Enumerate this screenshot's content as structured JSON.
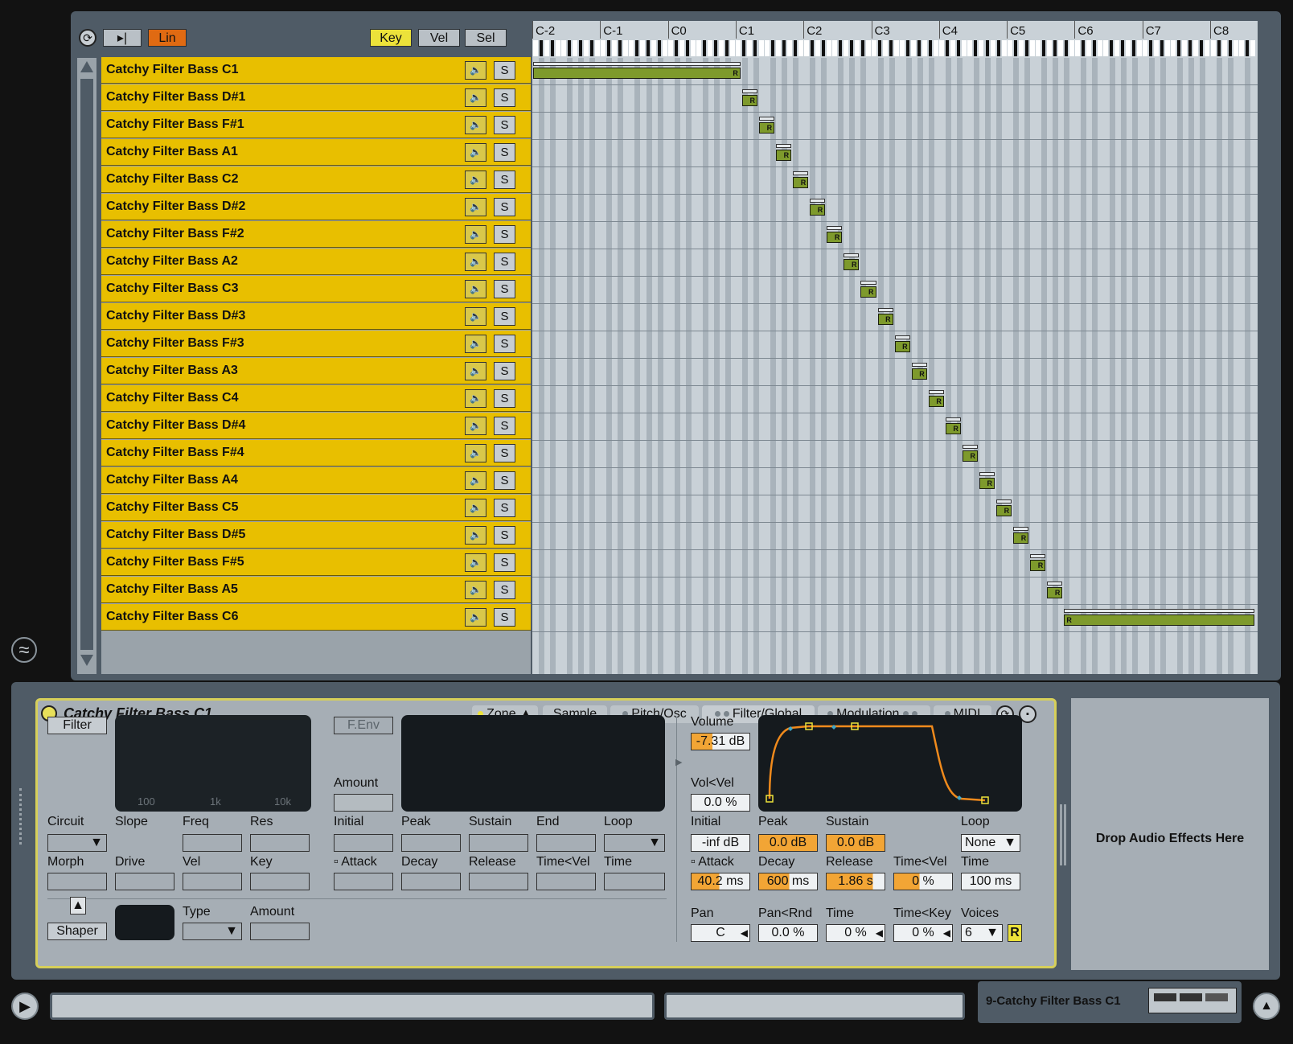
{
  "toolbar": {
    "lin_label": "Lin",
    "key_label": "Key",
    "vel_label": "Vel",
    "sel_label": "Sel"
  },
  "ruler_labels": [
    "C-2",
    "C-1",
    "C0",
    "C1",
    "C2",
    "C3",
    "C4",
    "C5",
    "C6",
    "C7",
    "C8"
  ],
  "zones": [
    {
      "name": "Catchy Filter Bass C1"
    },
    {
      "name": "Catchy Filter Bass D#1"
    },
    {
      "name": "Catchy Filter Bass F#1"
    },
    {
      "name": "Catchy Filter Bass A1"
    },
    {
      "name": "Catchy Filter Bass C2"
    },
    {
      "name": "Catchy Filter Bass D#2"
    },
    {
      "name": "Catchy Filter Bass F#2"
    },
    {
      "name": "Catchy Filter Bass A2"
    },
    {
      "name": "Catchy Filter Bass C3"
    },
    {
      "name": "Catchy Filter Bass D#3"
    },
    {
      "name": "Catchy Filter Bass F#3"
    },
    {
      "name": "Catchy Filter Bass A3"
    },
    {
      "name": "Catchy Filter Bass C4"
    },
    {
      "name": "Catchy Filter Bass D#4"
    },
    {
      "name": "Catchy Filter Bass F#4"
    },
    {
      "name": "Catchy Filter Bass A4"
    },
    {
      "name": "Catchy Filter Bass C5"
    },
    {
      "name": "Catchy Filter Bass D#5"
    },
    {
      "name": "Catchy Filter Bass F#5"
    },
    {
      "name": "Catchy Filter Bass A5"
    },
    {
      "name": "Catchy Filter Bass C6"
    }
  ],
  "zone_row_labels": {
    "solo": "S",
    "range_marker": "R"
  },
  "device": {
    "title": "Catchy Filter Bass C1",
    "tabs": {
      "zone": "Zone",
      "sample": "Sample",
      "pitch": "Pitch/Osc",
      "filter": "Filter/Global",
      "modulation": "Modulation",
      "midi": "MIDI"
    },
    "filter": {
      "filter_button": "Filter",
      "fenv_button": "F.Env",
      "amount_label": "Amount",
      "freq_ticks": [
        "100",
        "1k",
        "10k"
      ],
      "circuit": "Circuit",
      "slope": "Slope",
      "freq": "Freq",
      "res": "Res",
      "morph": "Morph",
      "drive": "Drive",
      "vel": "Vel",
      "key": "Key",
      "shaper": "Shaper",
      "type": "Type",
      "shaper_amount": "Amount"
    },
    "fenv": {
      "initial": "Initial",
      "peak": "Peak",
      "sustain": "Sustain",
      "end": "End",
      "loop": "Loop",
      "attack": "Attack",
      "decay": "Decay",
      "release": "Release",
      "time_vel": "Time<Vel",
      "time": "Time"
    },
    "amp": {
      "volume_label": "Volume",
      "volume_value": "-7.31 dB",
      "volvel_label": "Vol<Vel",
      "volvel_value": "0.0 %",
      "initial_label": "Initial",
      "initial_value": "-inf dB",
      "peak_label": "Peak",
      "peak_value": "0.0 dB",
      "sustain_label": "Sustain",
      "sustain_value": "0.0 dB",
      "loop_label": "Loop",
      "loop_value": "None",
      "attack_label": "Attack",
      "attack_value": "40.2 ms",
      "decay_label": "Decay",
      "decay_value": "600 ms",
      "release_label": "Release",
      "release_value": "1.86 s",
      "timevel_label": "Time<Vel",
      "timevel_value": "0 %",
      "time_label": "Time",
      "time_value": "100 ms",
      "pan_label": "Pan",
      "pan_value": "C",
      "panrnd_label": "Pan<Rnd",
      "panrnd_value": "0.0 %",
      "ptime_label": "Time",
      "ptime_value": "0 %",
      "timekey_label": "Time<Key",
      "timekey_value": "0 %",
      "voices_label": "Voices",
      "voices_value": "6",
      "retrigger_label": "R"
    }
  },
  "dropzone_text": "Drop Audio Effects Here",
  "statusbar": {
    "track_name": "9-Catchy Filter Bass C1"
  },
  "colors": {
    "zone_yellow": "#e8bf00",
    "zone_bar_green": "#7e9a2c",
    "lin_orange": "#e06a12",
    "key_yellow": "#ece23a",
    "envelope_orange": "#f08a1c"
  }
}
